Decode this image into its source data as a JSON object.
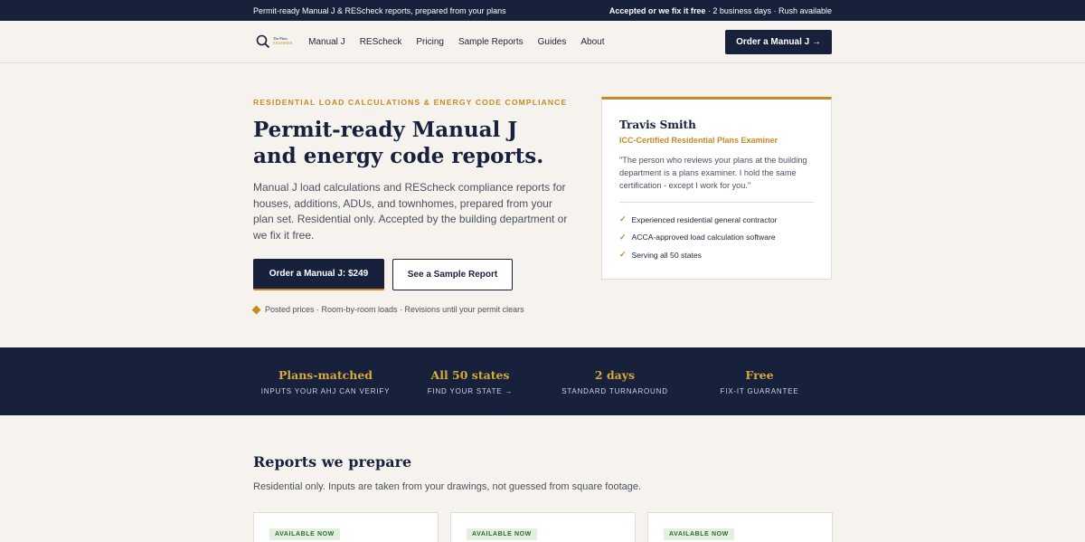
{
  "topbar": {
    "left": "Permit-ready Manual J & REScheck reports, prepared from your plans",
    "right_bold": "Accepted or we fix it free",
    "right_rest": " · 2 business days · Rush available"
  },
  "nav": {
    "logo_line1": "The Plans",
    "logo_line2": "EXAMINER",
    "items": [
      "Manual J",
      "REScheck",
      "Pricing",
      "Sample Reports",
      "Guides",
      "About"
    ],
    "cta": "Order a Manual J →"
  },
  "hero": {
    "eyebrow": "RESIDENTIAL LOAD CALCULATIONS & ENERGY CODE COMPLIANCE",
    "title": "Permit-ready Manual J and energy code reports.",
    "subtitle": "Manual J load calculations and REScheck compliance reports for houses, additions, ADUs, and townhomes, prepared from your plan set. Residential only. Accepted by the building department or we fix it free.",
    "primary_button": "Order a Manual J: $249",
    "secondary_button": "See a Sample Report",
    "note": "Posted prices · Room-by-room loads · Revisions until your permit clears"
  },
  "card": {
    "name": "Travis Smith",
    "role": "ICC-Certified Residential Plans Examiner",
    "quote": "\"The person who reviews your plans at the building department is a plans examiner. I hold the same certification - except I work for you.\"",
    "checks": [
      "Experienced residential general contractor",
      "ACCA-approved load calculation software",
      "Serving all 50 states"
    ]
  },
  "stats": [
    {
      "title": "Plans-matched",
      "sub": "INPUTS YOUR AHJ CAN VERIFY"
    },
    {
      "title": "All 50 states",
      "sub": "FIND YOUR STATE →"
    },
    {
      "title": "2 days",
      "sub": "STANDARD TURNAROUND"
    },
    {
      "title": "Free",
      "sub": "FIX-IT GUARANTEE"
    }
  ],
  "reports": {
    "title": "Reports we prepare",
    "subtitle": "Residential only. Inputs are taken from your drawings, not guessed from square footage.",
    "badges": [
      "AVAILABLE NOW",
      "AVAILABLE NOW",
      "AVAILABLE NOW"
    ]
  },
  "colors": {
    "navy": "#17213c",
    "gold": "#c68a25",
    "background": "#f6f3ee"
  }
}
